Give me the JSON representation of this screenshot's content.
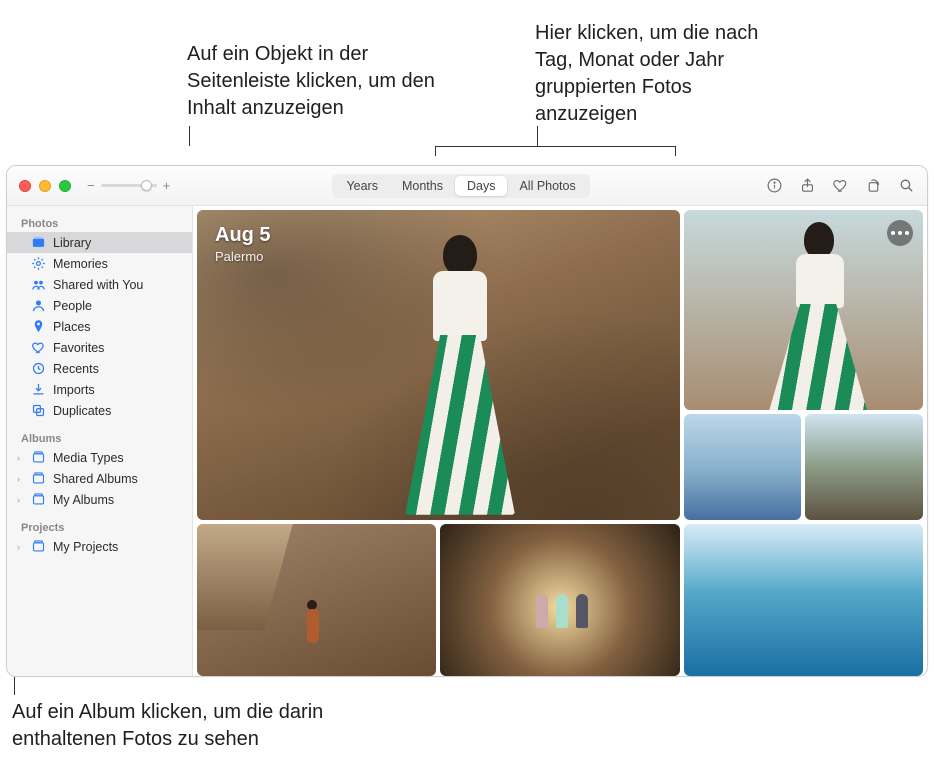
{
  "annotations": {
    "sidebar": "Auf ein Objekt in der Seitenleiste klicken, um den Inhalt anzuzeigen",
    "tabs": "Hier klicken, um die nach Tag, Monat oder Jahr gruppierten Fotos anzuzeigen",
    "album": "Auf ein Album klicken, um die darin enthaltenen Fotos zu sehen"
  },
  "toolbar": {
    "zoom": {
      "minus": "−",
      "plus": "+"
    },
    "view_tabs": [
      "Years",
      "Months",
      "Days",
      "All Photos"
    ],
    "selected_tab": "Days"
  },
  "sidebar": {
    "sections": [
      {
        "header": "Photos",
        "items": [
          {
            "label": "Library",
            "icon": "library",
            "selected": true,
            "expandable": false
          },
          {
            "label": "Memories",
            "icon": "memories",
            "selected": false,
            "expandable": false
          },
          {
            "label": "Shared with You",
            "icon": "shared",
            "selected": false,
            "expandable": false
          },
          {
            "label": "People",
            "icon": "people",
            "selected": false,
            "expandable": false
          },
          {
            "label": "Places",
            "icon": "places",
            "selected": false,
            "expandable": false
          },
          {
            "label": "Favorites",
            "icon": "favorites",
            "selected": false,
            "expandable": false
          },
          {
            "label": "Recents",
            "icon": "recents",
            "selected": false,
            "expandable": false
          },
          {
            "label": "Imports",
            "icon": "imports",
            "selected": false,
            "expandable": false
          },
          {
            "label": "Duplicates",
            "icon": "duplicates",
            "selected": false,
            "expandable": false
          }
        ]
      },
      {
        "header": "Albums",
        "items": [
          {
            "label": "Media Types",
            "icon": "album",
            "selected": false,
            "expandable": true
          },
          {
            "label": "Shared Albums",
            "icon": "album",
            "selected": false,
            "expandable": true
          },
          {
            "label": "My Albums",
            "icon": "album",
            "selected": false,
            "expandable": true
          }
        ]
      },
      {
        "header": "Projects",
        "items": [
          {
            "label": "My Projects",
            "icon": "album",
            "selected": false,
            "expandable": true
          }
        ]
      }
    ]
  },
  "content": {
    "date": "Aug 5",
    "location": "Palermo"
  },
  "colors": {
    "sidebar_icon": "#2f7cf6"
  }
}
